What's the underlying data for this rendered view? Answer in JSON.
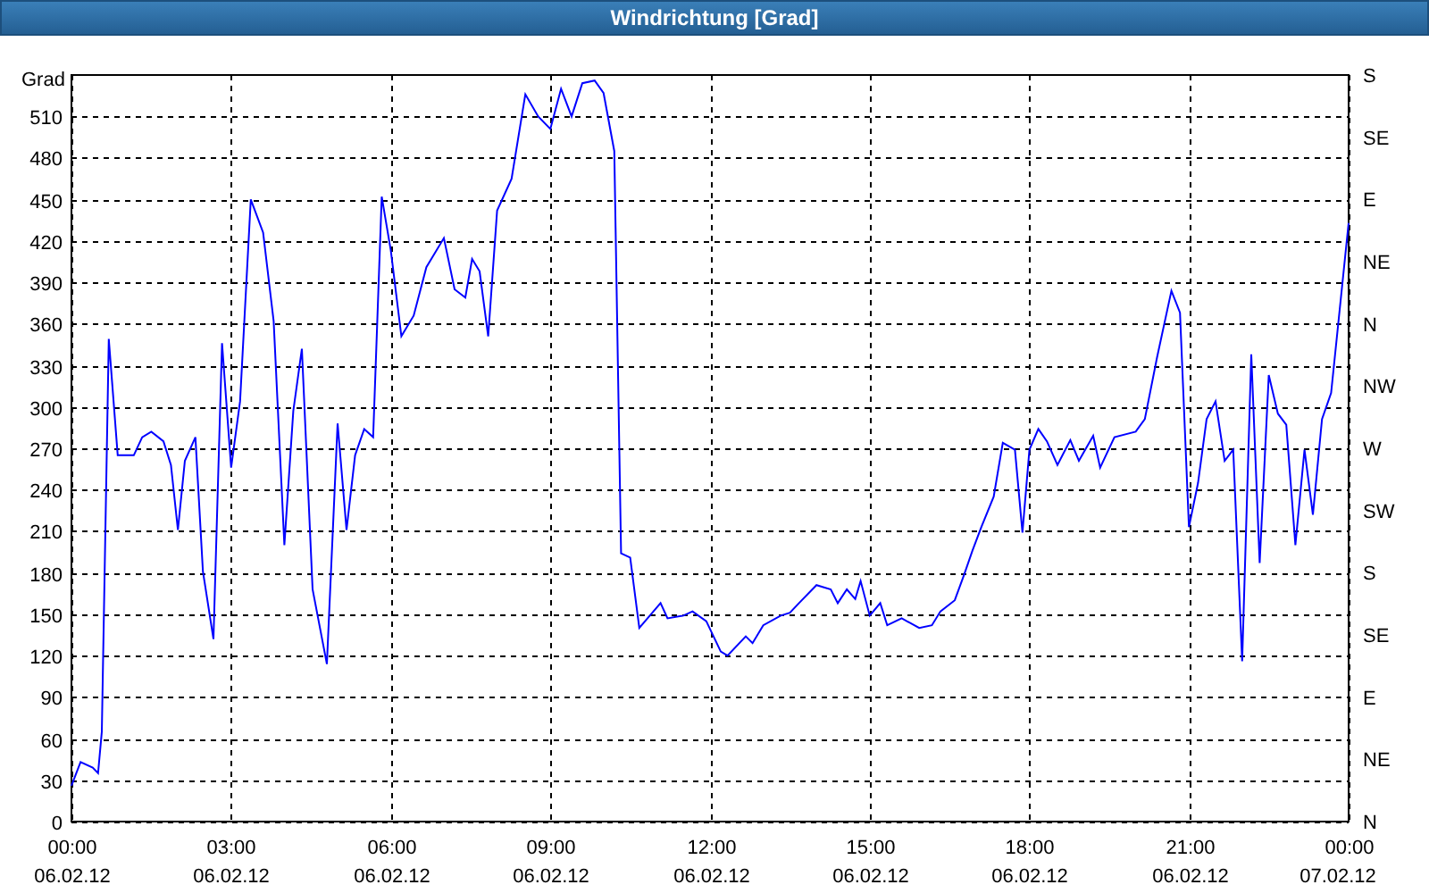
{
  "window": {
    "title": "Windrichtung [Grad]"
  },
  "chart": {
    "chart_data": {
      "type": "line",
      "ylabel": "Grad",
      "x": [
        0,
        0.17,
        0.4,
        0.5,
        0.57,
        0.7,
        0.87,
        1.17,
        1.33,
        1.5,
        1.73,
        1.87,
        2,
        2.13,
        2.33,
        2.47,
        2.67,
        2.83,
        3,
        3.17,
        3.37,
        3.6,
        3.8,
        4,
        4.17,
        4.33,
        4.53,
        4.8,
        5,
        5.17,
        5.33,
        5.5,
        5.67,
        5.83,
        6,
        6.2,
        6.43,
        6.67,
        7,
        7.2,
        7.4,
        7.53,
        7.67,
        7.83,
        8,
        8.27,
        8.53,
        8.77,
        9,
        9.2,
        9.4,
        9.6,
        9.83,
        10,
        10.2,
        10.33,
        10.5,
        10.67,
        10.87,
        11.07,
        11.2,
        11.5,
        11.67,
        11.93,
        12.2,
        12.33,
        12.67,
        12.8,
        13,
        13.33,
        13.5,
        13.67,
        14,
        14.27,
        14.4,
        14.57,
        14.73,
        14.83,
        15,
        15.2,
        15.33,
        15.6,
        15.93,
        16.17,
        16.33,
        16.6,
        16.77,
        16.93,
        17.1,
        17.33,
        17.5,
        17.73,
        17.87,
        18,
        18.17,
        18.33,
        18.53,
        18.77,
        18.93,
        19.2,
        19.33,
        19.6,
        20,
        20.17,
        20.4,
        20.67,
        20.83,
        21,
        21.17,
        21.33,
        21.5,
        21.67,
        21.83,
        22,
        22.17,
        22.33,
        22.5,
        22.67,
        22.83,
        23,
        23.17,
        23.33,
        23.5,
        23.67,
        24
      ],
      "series": [
        {
          "color": "#0000ff",
          "values": [
            26,
            43,
            39,
            35,
            65,
            349,
            265,
            265,
            278,
            282,
            275,
            258,
            211,
            261,
            278,
            181,
            132,
            346,
            256,
            304,
            450,
            426,
            362,
            200,
            297,
            342,
            168,
            114,
            288,
            211,
            265,
            284,
            278,
            452,
            413,
            351,
            366,
            401,
            422,
            385,
            379,
            407,
            398,
            351,
            442,
            465,
            526,
            510,
            501,
            530,
            510,
            534,
            536,
            527,
            485,
            194,
            191,
            140,
            149,
            158,
            147,
            149,
            152,
            145,
            123,
            120,
            134,
            129,
            142,
            149,
            151,
            158,
            171,
            168,
            158,
            168,
            161,
            174,
            149,
            158,
            142,
            147,
            140,
            142,
            152,
            160,
            178,
            196,
            213,
            235,
            274,
            269,
            209,
            269,
            284,
            275,
            258,
            276,
            261,
            279,
            256,
            278,
            282,
            291,
            336,
            384,
            368,
            213,
            245,
            291,
            304,
            261,
            269,
            116,
            338,
            187,
            323,
            295,
            287,
            200,
            269,
            222,
            291,
            310,
            433
          ]
        }
      ],
      "xlim": [
        0,
        24
      ],
      "ylim": [
        0,
        540
      ],
      "grid": true,
      "xticks": [
        {
          "value": 0,
          "label": "00:00"
        },
        {
          "value": 3,
          "label": "03:00"
        },
        {
          "value": 6,
          "label": "06:00"
        },
        {
          "value": 9,
          "label": "09:00"
        },
        {
          "value": 12,
          "label": "12:00"
        },
        {
          "value": 15,
          "label": "15:00"
        },
        {
          "value": 18,
          "label": "18:00"
        },
        {
          "value": 21,
          "label": "21:00"
        },
        {
          "value": 24,
          "label": "00:00"
        }
      ],
      "yticks": [
        {
          "value": 0,
          "label": "0"
        },
        {
          "value": 30,
          "label": "30"
        },
        {
          "value": 60,
          "label": "60"
        },
        {
          "value": 90,
          "label": "90"
        },
        {
          "value": 120,
          "label": "120"
        },
        {
          "value": 150,
          "label": "150"
        },
        {
          "value": 180,
          "label": "180"
        },
        {
          "value": 210,
          "label": "210"
        },
        {
          "value": 240,
          "label": "240"
        },
        {
          "value": 270,
          "label": "270"
        },
        {
          "value": 300,
          "label": "300"
        },
        {
          "value": 330,
          "label": "330"
        },
        {
          "value": 360,
          "label": "360"
        },
        {
          "value": 390,
          "label": "390"
        },
        {
          "value": 420,
          "label": "420"
        },
        {
          "value": 450,
          "label": "450"
        },
        {
          "value": 480,
          "label": "480"
        },
        {
          "value": 510,
          "label": "510"
        }
      ]
    },
    "date_labels": [
      "06.02.12",
      "06.02.12",
      "06.02.12",
      "06.02.12",
      "06.02.12",
      "06.02.12",
      "06.02.12",
      "06.02.12",
      "07.02.12"
    ],
    "direction_labels": [
      "S",
      "SE",
      "E",
      "NE",
      "N",
      "NW",
      "W",
      "SW",
      "S",
      "SE",
      "E",
      "NE",
      "N"
    ]
  }
}
